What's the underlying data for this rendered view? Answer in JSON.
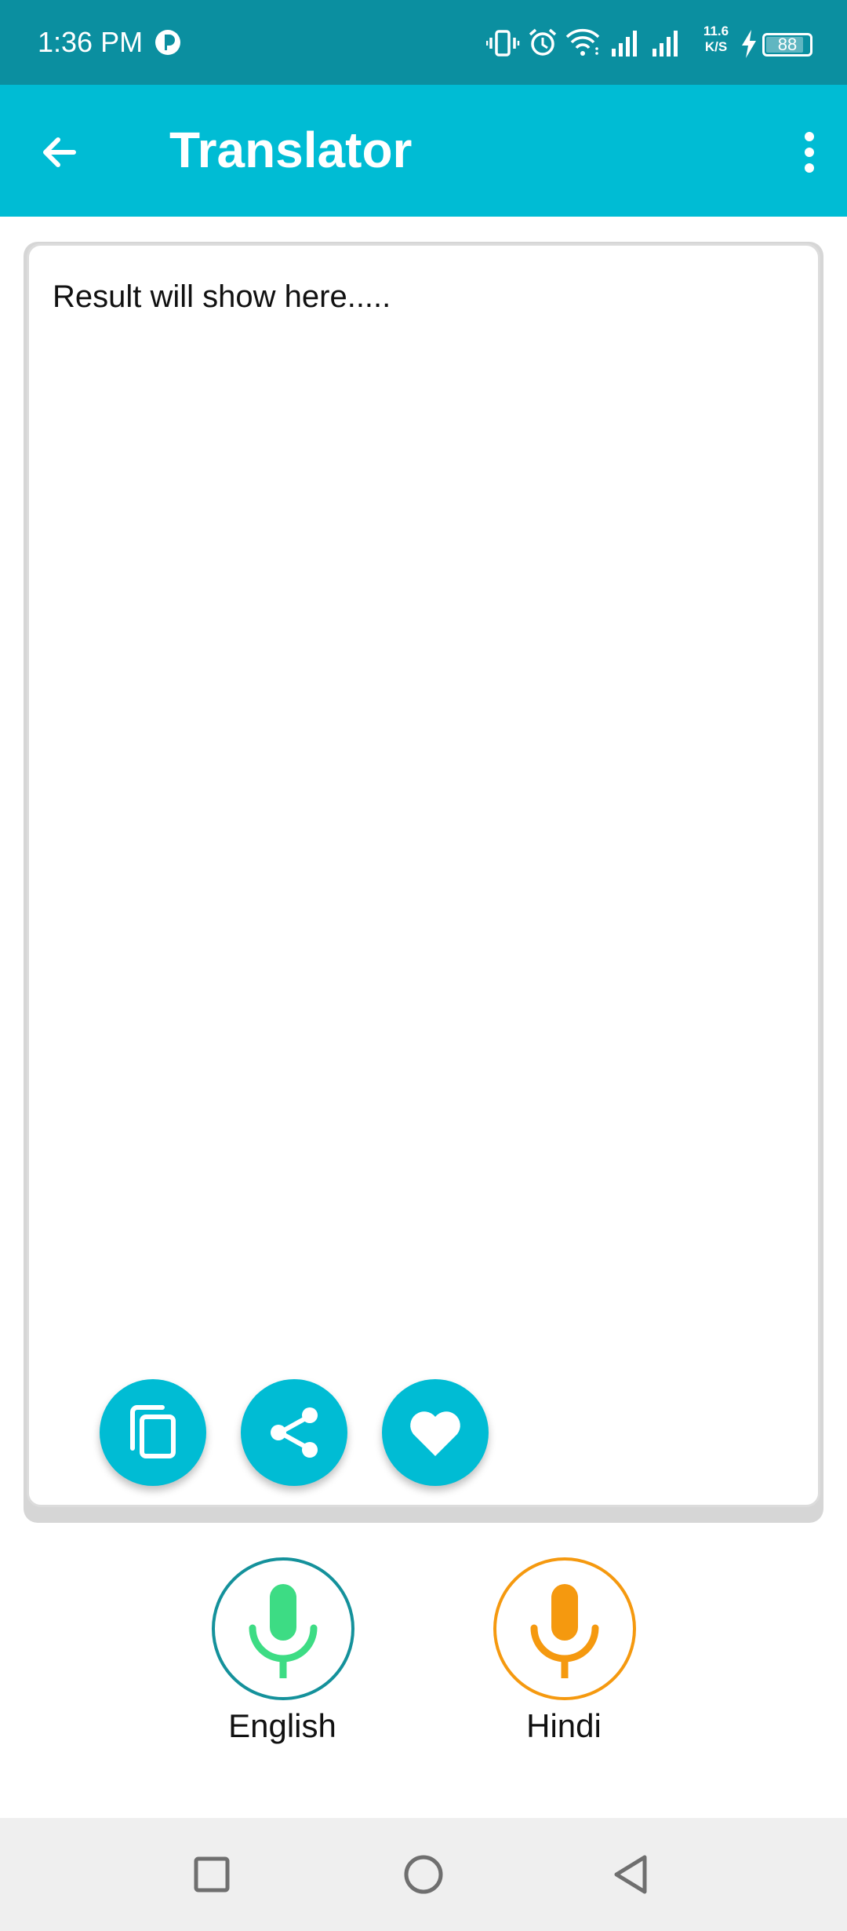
{
  "status_bar": {
    "time": "1:36 PM",
    "network_speed_value": "11.6",
    "network_speed_unit": "K/S",
    "battery_level": "88",
    "battery_percent": 88,
    "icons": [
      "vibrate-icon",
      "alarm-icon",
      "wifi-icon",
      "signal-icon",
      "signal-icon",
      "charging-icon",
      "battery-icon"
    ],
    "background": "#0b8fa0"
  },
  "app_bar": {
    "title": "Translator",
    "background": "#00bcd4",
    "back_icon": "arrow-left-icon",
    "menu_icon": "more-vert-icon"
  },
  "result": {
    "placeholder_text": "Result will show here.....",
    "actions": [
      {
        "name": "copy",
        "icon": "copy-icon"
      },
      {
        "name": "share",
        "icon": "share-icon"
      },
      {
        "name": "favorite",
        "icon": "heart-icon"
      }
    ],
    "action_color": "#00bcd4"
  },
  "mic_buttons": [
    {
      "label": "English",
      "ring_color": "#14919b",
      "mic_color": "#3ddc84"
    },
    {
      "label": "Hindi",
      "ring_color": "#f5990f",
      "mic_color": "#f5990f"
    }
  ],
  "nav_bar": {
    "buttons": [
      "recents-icon",
      "home-icon",
      "back-triangle-icon"
    ]
  }
}
